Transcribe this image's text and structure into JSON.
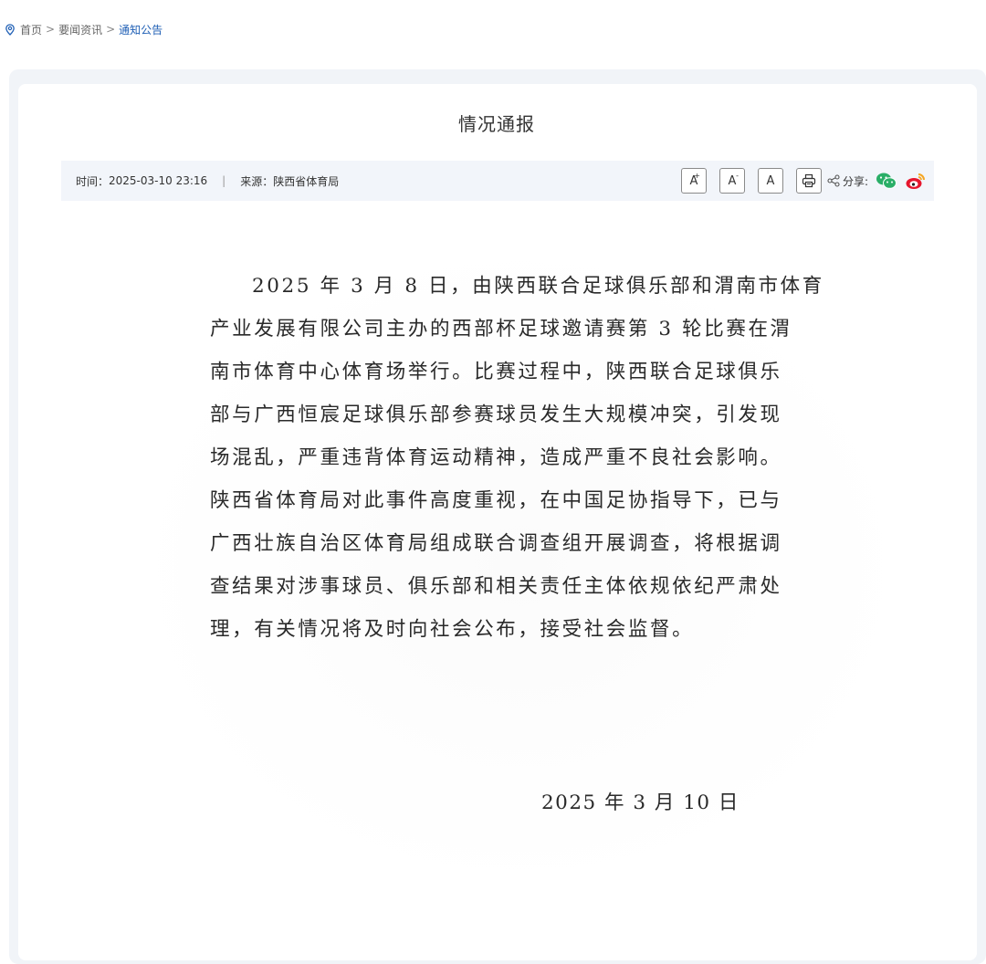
{
  "breadcrumb": {
    "items": [
      "首页",
      "要闻资讯",
      "通知公告"
    ],
    "separator": ">"
  },
  "article": {
    "title": "情况通报",
    "meta": {
      "time_label": "时间：",
      "time_value": "2025-03-10 23:16",
      "divider": "|",
      "source_label": "来源：",
      "source_value": "陕西省体育局"
    },
    "toolbar": {
      "font_larger": "A",
      "font_smaller": "A",
      "font_reset": "A",
      "share_label": "分享:"
    },
    "body_lines": [
      "2025 年 3 月 8 日，由陕西联合足球俱乐部和渭南市体育",
      "产业发展有限公司主办的西部杯足球邀请赛第 3 轮比赛在渭",
      "南市体育中心体育场举行。比赛过程中，陕西联合足球俱乐",
      "部与广西恒宸足球俱乐部参赛球员发生大规模冲突，引发现",
      "场混乱，严重违背体育运动精神，造成严重不良社会影响。",
      "陕西省体育局对此事件高度重视，在中国足协指导下，已与",
      "广西壮族自治区体育局组成联合调查组开展调查，将根据调",
      "查结果对涉事球员、俱乐部和相关责任主体依规依纪严肃处",
      "理，有关情况将及时向社会公布，接受社会监督。"
    ],
    "sign_date": "2025 年 3 月 10 日"
  },
  "colors": {
    "link_active": "#1f5fb5",
    "meta_bg": "#f2f5fa",
    "outer_bg": "#f1f4f8",
    "wechat": "#2aae67",
    "weibo": "#e6162d"
  }
}
